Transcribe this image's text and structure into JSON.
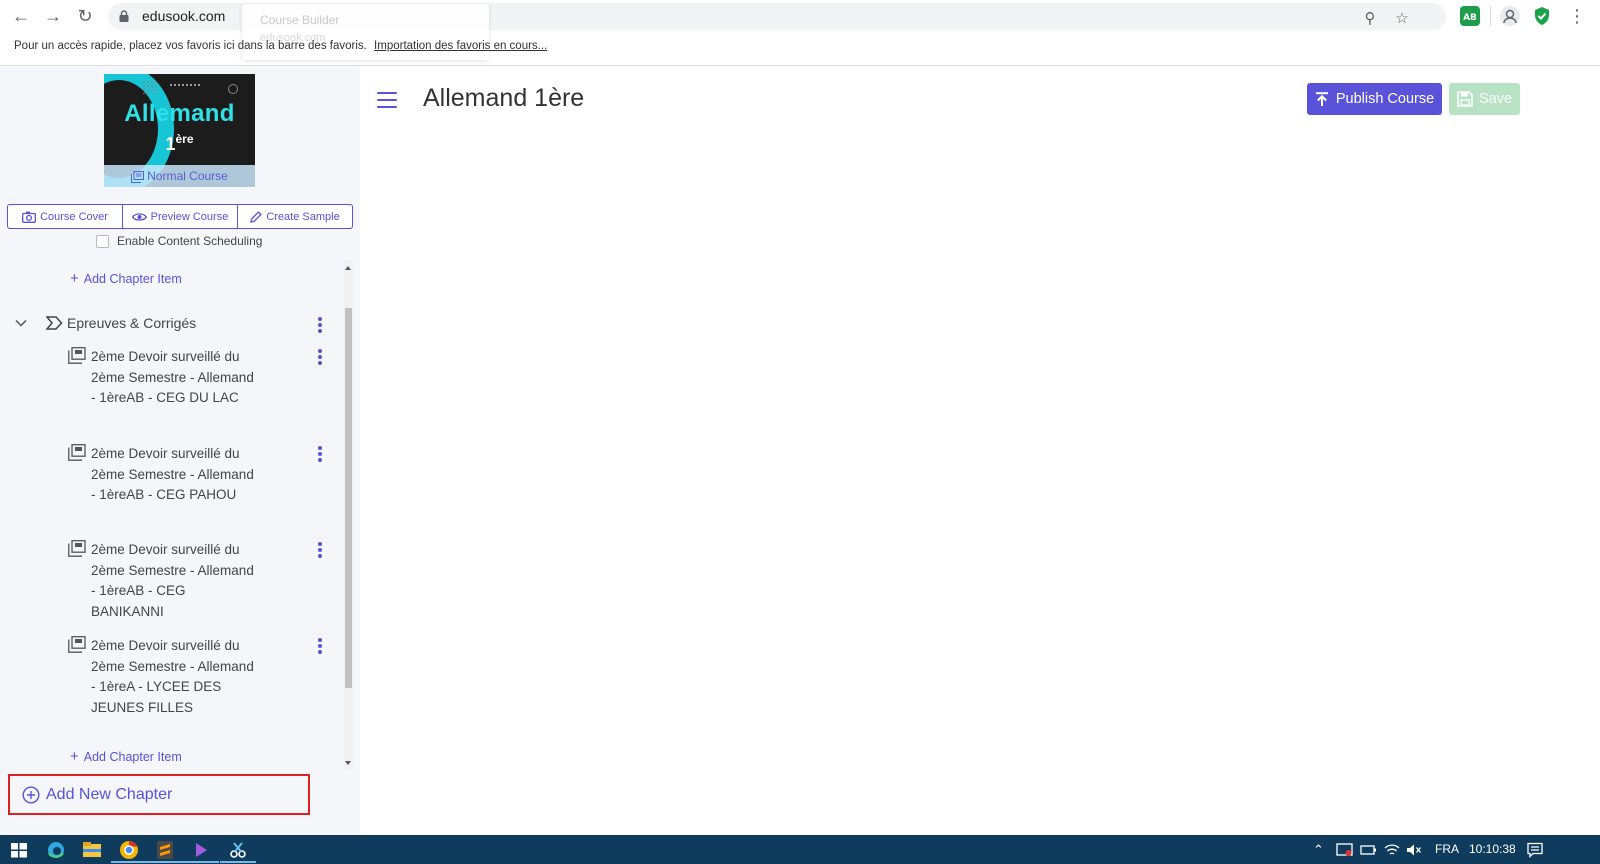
{
  "browser": {
    "url": "edusook.com",
    "tooltip_title": "Course Builder",
    "tooltip_url": "edusook.com",
    "bookmarks_text": "Pour un accès rapide, placez vos favoris ici dans la barre des favoris.",
    "bookmarks_link": "Importation des favoris en cours..."
  },
  "sidebar": {
    "cover": {
      "title": "Allemand",
      "subtitle_main": "1",
      "subtitle_sup": "ère",
      "badge": "Normal Course"
    },
    "actions": {
      "course_cover": "Course Cover",
      "preview_course": "Preview Course",
      "create_sample": "Create Sample"
    },
    "scheduling_label": "Enable Content Scheduling",
    "add_chapter_item": "Add Chapter Item",
    "chapter": {
      "title": "Epreuves & Corrigés",
      "items": [
        {
          "label": "2ème Devoir surveillé du 2ème Semestre - Allemand - 1èreAB - CEG DU LAC"
        },
        {
          "label": "2ème Devoir surveillé du 2ème Semestre - Allemand - 1èreAB - CEG PAHOU"
        },
        {
          "label": "2ème Devoir surveillé du 2ème Semestre - Allemand - 1èreAB - CEG BANIKANNI"
        },
        {
          "label": "2ème Devoir surveillé du 2ème Semestre - Allemand - 1èreA - LYCEE DES JEUNES FILLES"
        }
      ]
    },
    "add_new_chapter": "Add New Chapter"
  },
  "main": {
    "title": "Allemand 1ère",
    "publish_label": "Publish Course",
    "save_label": "Save"
  },
  "taskbar": {
    "language": "FRA",
    "time": "10:10:38"
  },
  "colors": {
    "accent": "#5a52d8",
    "save_disabled": "#b7e3c4",
    "highlight_box": "#e02020",
    "taskbar": "#0f3c5c"
  }
}
